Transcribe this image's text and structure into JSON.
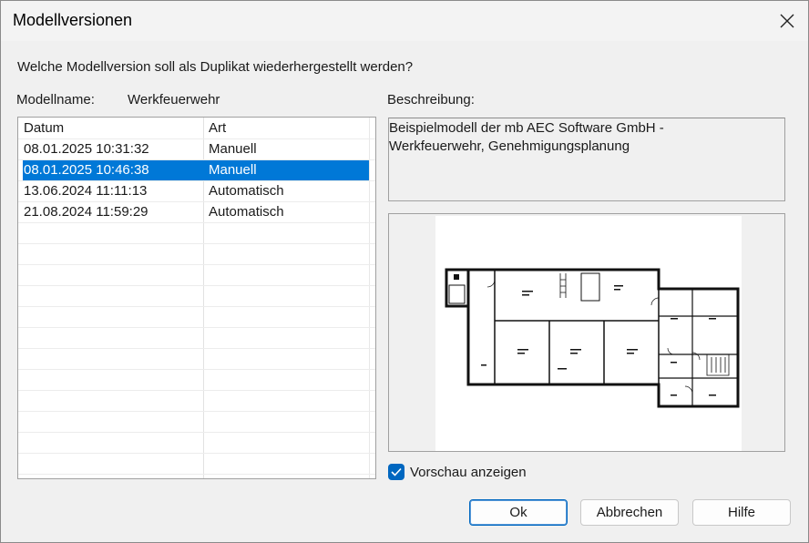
{
  "window": {
    "title": "Modellversionen"
  },
  "prompt": "Welche Modellversion soll als Duplikat wiederhergestellt werden?",
  "model": {
    "label": "Modellname:",
    "value": "Werkfeuerwehr"
  },
  "description": {
    "label": "Beschreibung:",
    "line1": "Beispielmodell der mb AEC Software GmbH -",
    "line2": "Werkfeuerwehr, Genehmigungsplanung"
  },
  "table": {
    "headers": [
      "Datum",
      "Art"
    ],
    "rows": [
      {
        "date": "08.01.2025 10:31:32",
        "type": "Manuell"
      },
      {
        "date": "08.01.2025 10:46:38",
        "type": "Manuell"
      },
      {
        "date": "13.06.2024 11:11:13",
        "type": "Automatisch"
      },
      {
        "date": "21.08.2024 11:59:29",
        "type": "Automatisch"
      }
    ],
    "selected_index": 1
  },
  "preview_checkbox": {
    "label": "Vorschau anzeigen",
    "checked": true
  },
  "buttons": {
    "ok": "Ok",
    "cancel": "Abbrechen",
    "help": "Hilfe"
  },
  "colors": {
    "selection": "#0078d7",
    "checkbox": "#0067c0"
  }
}
